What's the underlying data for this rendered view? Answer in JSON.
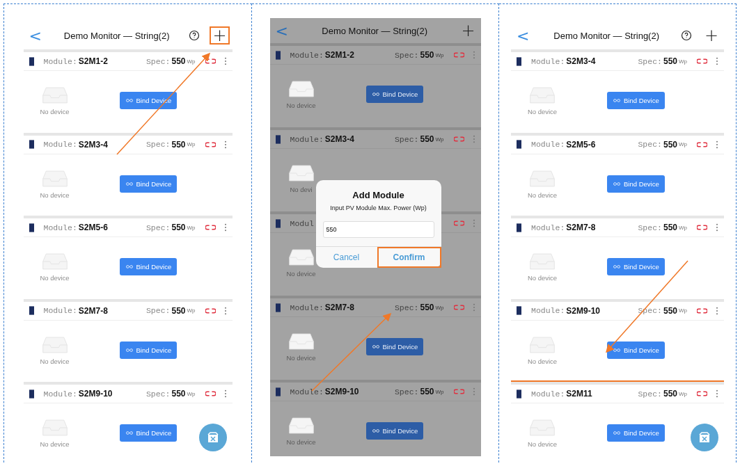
{
  "screens": [
    {
      "title": "Demo Monitor — String(2)",
      "back": "<",
      "add": "+",
      "add_highlighted": true,
      "help": true,
      "dimmed": false,
      "fab": true,
      "rows": [
        {
          "module_label": "Module:",
          "module": "S2M1-2",
          "spec_label": "Spec:",
          "spec": "550",
          "unit": "Wp",
          "no_device": "No device",
          "bind": "Bind Device",
          "highlighted": false
        },
        {
          "module_label": "Module:",
          "module": "S2M3-4",
          "spec_label": "Spec:",
          "spec": "550",
          "unit": "Wp",
          "no_device": "No device",
          "bind": "Bind Device",
          "highlighted": false
        },
        {
          "module_label": "Module:",
          "module": "S2M5-6",
          "spec_label": "Spec:",
          "spec": "550",
          "unit": "Wp",
          "no_device": "No device",
          "bind": "Bind Device",
          "highlighted": false
        },
        {
          "module_label": "Module:",
          "module": "S2M7-8",
          "spec_label": "Spec:",
          "spec": "550",
          "unit": "Wp",
          "no_device": "No device",
          "bind": "Bind Device",
          "highlighted": false
        },
        {
          "module_label": "Module:",
          "module": "S2M9-10",
          "spec_label": "Spec:",
          "spec": "550",
          "unit": "Wp",
          "no_device": "No device",
          "bind": "Bind Device",
          "highlighted": false
        }
      ]
    },
    {
      "title": "Demo Monitor — String(2)",
      "back": "<",
      "add": "+",
      "add_highlighted": false,
      "help": false,
      "dimmed": true,
      "fab": false,
      "rows": [
        {
          "module_label": "Module:",
          "module": "S2M1-2",
          "spec_label": "Spec:",
          "spec": "550",
          "unit": "Wp",
          "no_device": "No device",
          "bind": "Bind Device",
          "highlighted": false
        },
        {
          "module_label": "Module:",
          "module": "S2M3-4",
          "spec_label": "Spec:",
          "spec": "550",
          "unit": "Wp",
          "no_device": "No devi",
          "highlighted": false
        },
        {
          "module_label": "Modul",
          "no_device": "No device",
          "highlighted": false
        },
        {
          "module_label": "Module:",
          "module": "S2M7-8",
          "spec_label": "Spec:",
          "spec": "550",
          "unit": "Wp",
          "no_device": "No device",
          "bind": "Bind Device",
          "highlighted": false
        },
        {
          "module_label": "Module:",
          "module": "S2M9-10",
          "spec_label": "Spec:",
          "spec": "550",
          "unit": "Wp",
          "no_device": "No device",
          "bind": "Bind Device",
          "highlighted": false
        }
      ],
      "dialog": {
        "title": "Add Module",
        "message": "Input PV Module Max. Power (Wp)",
        "value": "550",
        "cancel": "Cancel",
        "confirm": "Confirm",
        "confirm_highlighted": true
      }
    },
    {
      "title": "Demo Monitor — String(2)",
      "back": "<",
      "add": "+",
      "add_highlighted": false,
      "help": true,
      "dimmed": false,
      "fab": true,
      "rows": [
        {
          "module_label": "Module:",
          "module": "S2M3-4",
          "spec_label": "Spec:",
          "spec": "550",
          "unit": "Wp",
          "no_device": "No device",
          "bind": "Bind Device",
          "highlighted": false
        },
        {
          "module_label": "Module:",
          "module": "S2M5-6",
          "spec_label": "Spec:",
          "spec": "550",
          "unit": "Wp",
          "no_device": "No device",
          "bind": "Bind Device",
          "highlighted": false
        },
        {
          "module_label": "Module:",
          "module": "S2M7-8",
          "spec_label": "Spec:",
          "spec": "550",
          "unit": "Wp",
          "no_device": "No device",
          "bind": "Bind Device",
          "highlighted": false
        },
        {
          "module_label": "Module:",
          "module": "S2M9-10",
          "spec_label": "Spec:",
          "spec": "550",
          "unit": "Wp",
          "no_device": "No device",
          "bind": "Bind Device",
          "highlighted": false
        },
        {
          "module_label": "Module:",
          "module": "S2M11",
          "spec_label": "Spec:",
          "spec": "550",
          "unit": "Wp",
          "no_device": "No device",
          "bind": "Bind Device",
          "highlighted": true
        }
      ]
    }
  ]
}
